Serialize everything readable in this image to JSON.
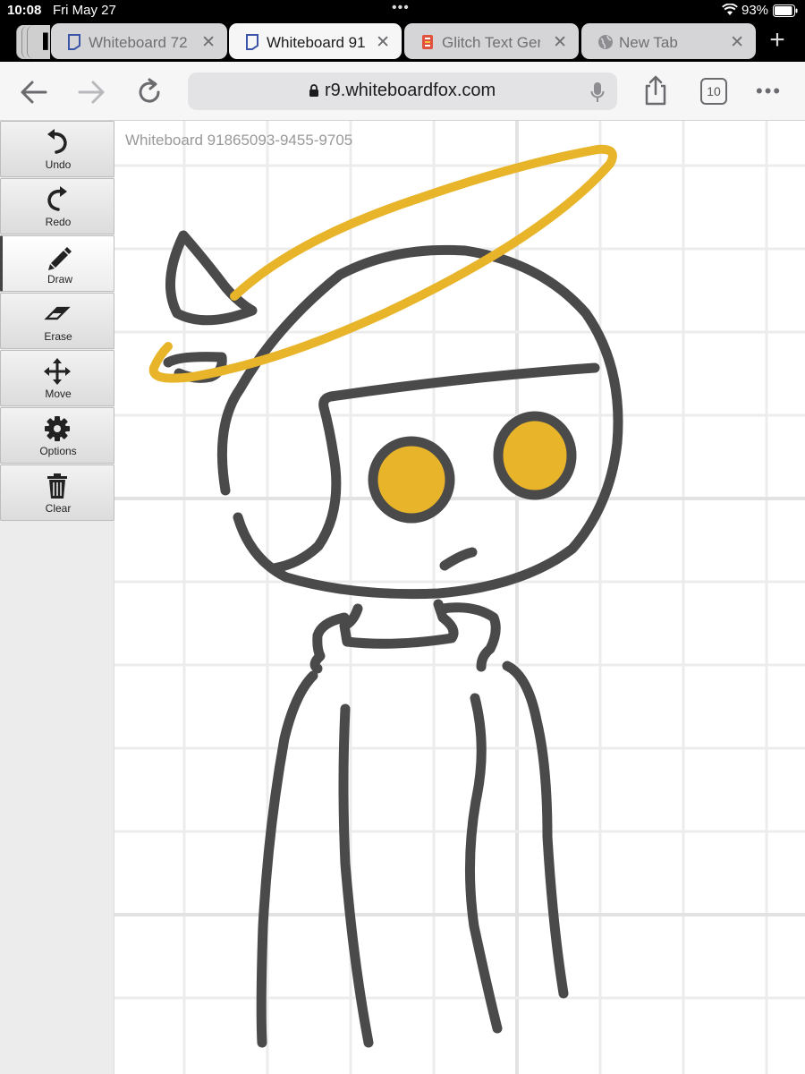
{
  "status_bar": {
    "time": "10:08",
    "date": "Fri May 27",
    "battery_percent": "93%",
    "battery_level": 0.93
  },
  "tabs": [
    {
      "title": "Whiteboard 72",
      "icon": "whiteboard-page-icon",
      "active": false
    },
    {
      "title": "Whiteboard 91",
      "icon": "whiteboard-page-icon",
      "active": true
    },
    {
      "title": "Glitch Text Ger",
      "icon": "glitch-text-favicon",
      "active": false
    },
    {
      "title": "New Tab",
      "icon": "globe-icon",
      "active": false
    }
  ],
  "address_bar": {
    "url": "r9.whiteboardfox.com",
    "tab_count": "10"
  },
  "whiteboard": {
    "id_label": "Whiteboard 91865093-9455-9705"
  },
  "toolbar": {
    "tools": [
      {
        "label": "Undo",
        "icon": "undo-icon"
      },
      {
        "label": "Redo",
        "icon": "redo-icon"
      },
      {
        "label": "Draw",
        "icon": "pencil-icon",
        "active": true
      },
      {
        "label": "Erase",
        "icon": "eraser-icon"
      },
      {
        "label": "Move",
        "icon": "move-arrows-icon"
      },
      {
        "label": "Options",
        "icon": "gear-icon"
      },
      {
        "label": "Clear",
        "icon": "trash-icon"
      }
    ]
  },
  "colors": {
    "ink": "#4a4a4a",
    "accent_yellow": "#e8b52a",
    "grid": "#ececec",
    "grid_major": "#e2e2e2"
  }
}
